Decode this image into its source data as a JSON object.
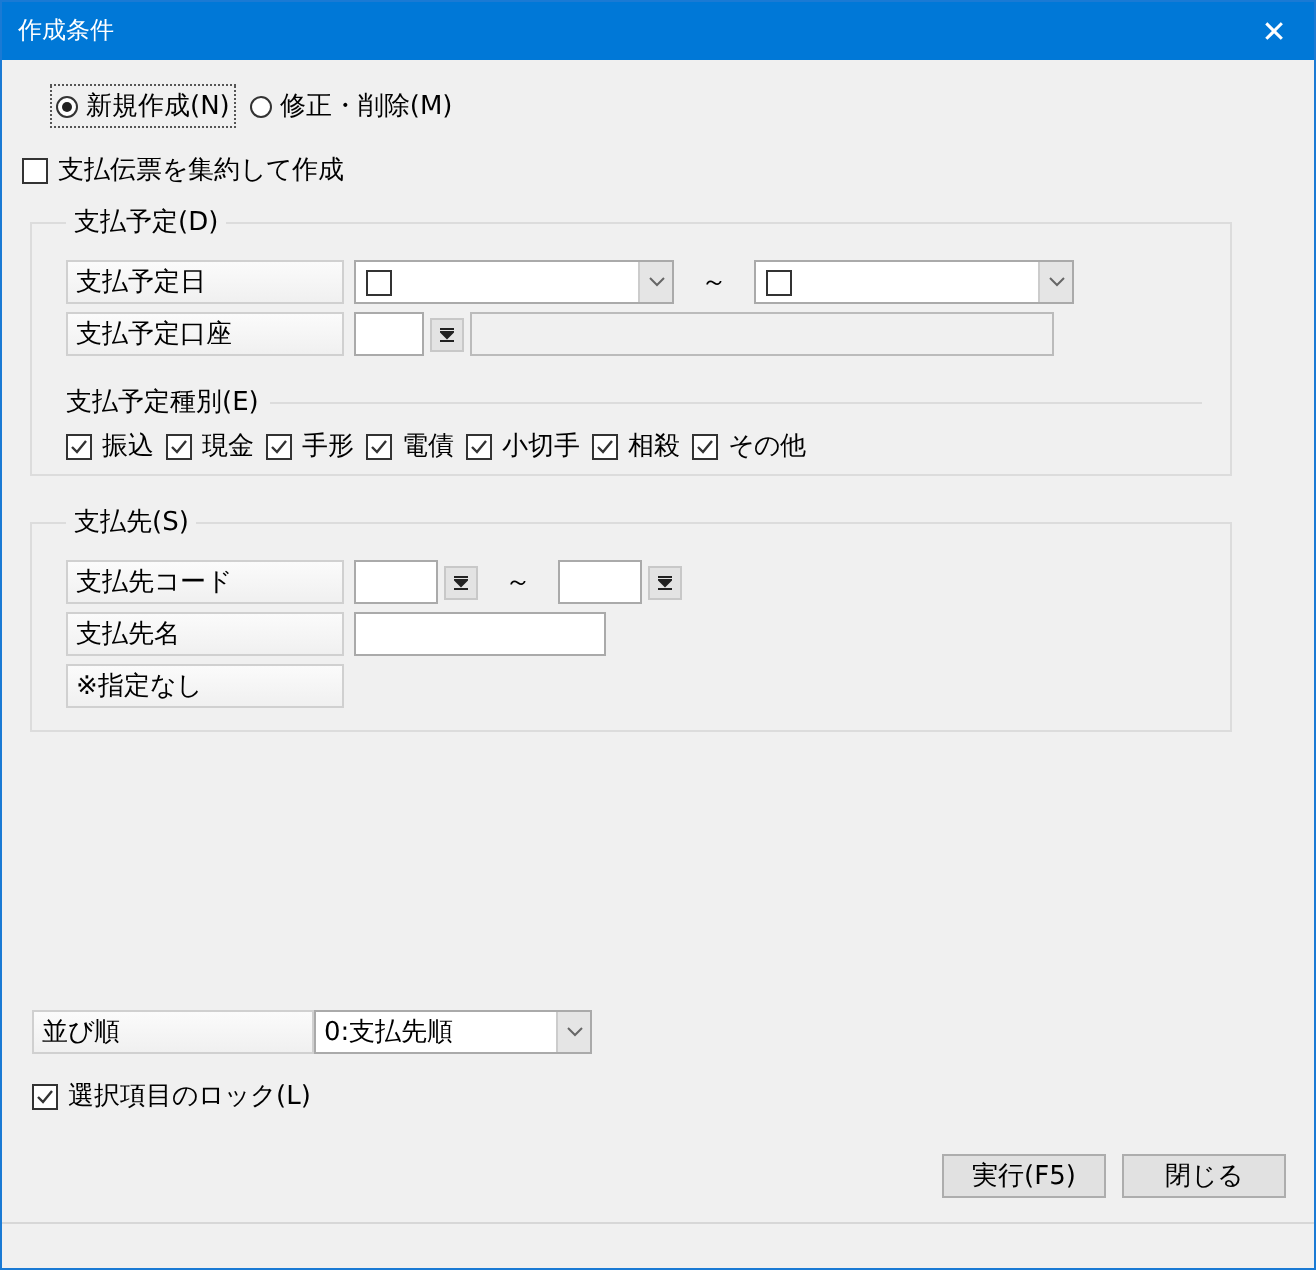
{
  "window": {
    "title": "作成条件",
    "close": "✕"
  },
  "mode_options": [
    {
      "label": "新規作成(N)",
      "selected": true
    },
    {
      "label": "修正・削除(M)",
      "selected": false
    }
  ],
  "aggregate": {
    "label": "支払伝票を集約して作成",
    "checked": false
  },
  "schedule_group": {
    "title": "支払予定(D)",
    "date": {
      "label": "支払予定日",
      "from_checked": false,
      "separator": "～",
      "to_checked": false
    },
    "account": {
      "label": "支払予定口座"
    },
    "types_title": "支払予定種別(E)",
    "types": [
      {
        "label": "振込",
        "checked": true
      },
      {
        "label": "現金",
        "checked": true
      },
      {
        "label": "手形",
        "checked": true
      },
      {
        "label": "電債",
        "checked": true
      },
      {
        "label": "小切手",
        "checked": true
      },
      {
        "label": "相殺",
        "checked": true
      },
      {
        "label": "その他",
        "checked": true
      }
    ]
  },
  "payee_group": {
    "title": "支払先(S)",
    "code": {
      "label": "支払先コード",
      "separator": "～"
    },
    "name": {
      "label": "支払先名"
    },
    "note": "※指定なし"
  },
  "sort": {
    "label": "並び順",
    "value": "0:支払先順"
  },
  "lock": {
    "label": "選択項目のロック(L)",
    "checked": true
  },
  "buttons": [
    "実行(F5)",
    "閉じる"
  ]
}
